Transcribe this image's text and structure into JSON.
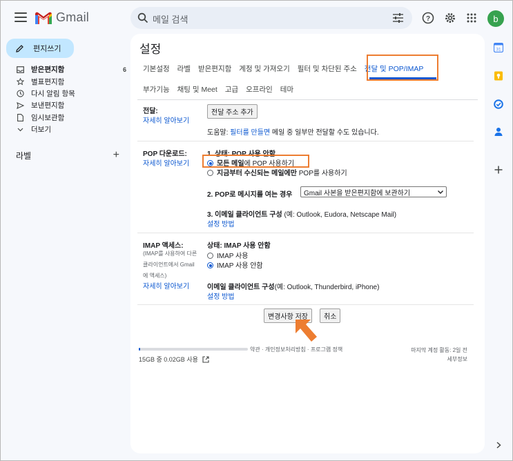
{
  "header": {
    "app_name": "Gmail",
    "search_placeholder": "메일 검색",
    "avatar_letter": "b"
  },
  "sidebar": {
    "compose_label": "편지쓰기",
    "items": [
      {
        "label": "받은편지함",
        "count": "6",
        "icon": "inbox-icon"
      },
      {
        "label": "별표편지함",
        "count": "",
        "icon": "star-icon"
      },
      {
        "label": "다시 알림 항목",
        "count": "",
        "icon": "clock-icon"
      },
      {
        "label": "보낸편지함",
        "count": "",
        "icon": "send-icon"
      },
      {
        "label": "임시보관함",
        "count": "",
        "icon": "draft-icon"
      },
      {
        "label": "더보기",
        "count": "",
        "icon": "chevron-down-icon"
      }
    ],
    "labels_title": "라벨",
    "labels_add": "+"
  },
  "settings": {
    "title": "설정",
    "tabs_row1": [
      "기본설정",
      "라벨",
      "받은편지함",
      "계정 및 가져오기",
      "필터 및 차단된 주소",
      "전달 및 POP/IMAP"
    ],
    "tabs_row2": [
      "부가기능",
      "채팅 및 Meet",
      "고급",
      "오프라인",
      "테마"
    ],
    "forwarding": {
      "label": "전달:",
      "learn_more": "자세히 알아보기",
      "add_button": "전달 주소 추가",
      "tip_prefix": "도움말: ",
      "tip_link": "필터를 만들면",
      "tip_suffix": " 메일 중 일부만 전달할 수도 있습니다."
    },
    "pop": {
      "label": "POP 다운로드:",
      "learn_more": "자세히 알아보기",
      "status": "1. 상태: POP 사용 안함",
      "option1_bold": "모든 메일",
      "option1_rest": "에 POP 사용하기",
      "option2_bold": "지금부터 수신되는 메일에만",
      "option2_rest": " POP를 사용하기",
      "step2_label": "2. POP로 메시지를 여는 경우",
      "step2_select": "Gmail 사본을 받은편지함에 보관하기",
      "step3_label": "3. 이메일 클라이언트 구성",
      "step3_example": " (예: Outlook, Eudora, Netscape Mail)",
      "setup_link": "설정 방법"
    },
    "imap": {
      "label": "IMAP 액세스:",
      "desc_line1": "(IMAP를 사용하여 다른",
      "desc_line2": "클라이언트에서 Gmail",
      "desc_line3": "에 액세스)",
      "learn_more": "자세히 알아보기",
      "status": "상태: IMAP 사용 안함",
      "option_on": "IMAP 사용",
      "option_off": "IMAP 사용 안함",
      "client_label": "이메일 클라이언트 구성",
      "client_example": "(예: Outlook, Thunderbird, iPhone)",
      "setup_link": "설정 방법"
    },
    "save_button": "변경사항 저장",
    "cancel_button": "취소"
  },
  "footer": {
    "storage": "15GB 중 0.02GB 사용",
    "storage_fraction": 0.0013,
    "links": "약관 · 개인정보처리방침 · 프로그램 정책",
    "last_activity": "마지막 계정 활동: 2일 전",
    "details": "세부정보"
  },
  "colors": {
    "accent": "#0b57d0",
    "annotation": "#ed7d31",
    "compose_bg": "#c2e7ff"
  }
}
